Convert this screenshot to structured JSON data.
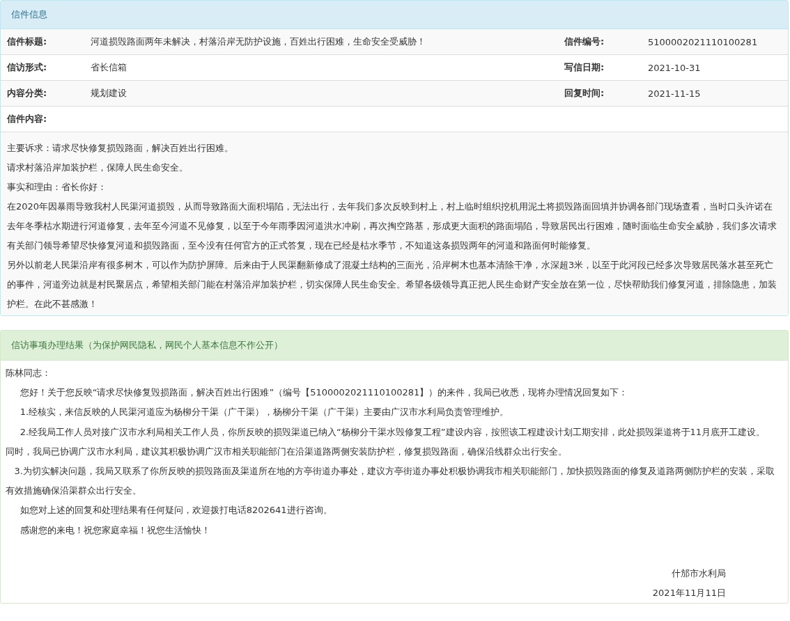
{
  "letter_info": {
    "title": "信件信息",
    "rows": [
      {
        "label": "信件标题:",
        "value": "河道损毁路面两年未解决，村落沿岸无防护设施，百姓出行困难，生命安全受威胁！",
        "label2": "信件编号:",
        "value2": "5100002021110100281"
      },
      {
        "label": "信访形式:",
        "value": "省长信箱",
        "label2": "写信日期:",
        "value2": "2021-10-31"
      },
      {
        "label": "内容分类:",
        "value": "规划建设",
        "label2": "回复时间:",
        "value2": "2021-11-15"
      }
    ],
    "content_label": "信件内容:",
    "content": [
      "主要诉求：请求尽快修复损毁路面，解决百姓出行困难。",
      "请求村落沿岸加装护栏，保障人民生命安全。",
      "事实和理由：省长你好：",
      "在2020年因暴雨导致我村人民渠河道损毁，从而导致路面大面积塌陷，无法出行，去年我们多次反映到村上，村上临时组织挖机用泥土将损毁路面回填并协调各部门现场查看，当时口头许诺在去年冬季枯水期进行河道修复，去年至今河道不见修复，以至于今年雨季因河道洪水冲刷，再次掏空路基，形成更大面积的路面塌陷，导致居民出行困难，随时面临生命安全威胁，我们多次请求有关部门领导希望尽快修复河道和损毁路面，至今没有任何官方的正式答复，现在已经是枯水季节，不知道这条损毁两年的河道和路面何时能修复。",
      "另外以前老人民渠沿岸有很多树木，可以作为防护屏障。后来由于人民渠翻新修成了混凝土结构的三面光，沿岸树木也基本清除干净，水深超3米，以至于此河段已经多次导致居民落水甚至死亡的事件，河道旁边就是村民聚居点，希望相关部门能在村落沿岸加装护栏，切实保障人民生命安全。希望各级领导真正把人民生命财产安全放在第一位，尽快帮助我们修复河道，排除隐患，加装护栏。在此不甚感激！"
    ]
  },
  "reply": {
    "title": "信访事项办理结果（为保护网民隐私，网民个人基本信息不作公开）",
    "paragraphs": [
      "陈林同志：",
      "     您好！关于您反映“请求尽快修复毁损路面，解决百姓出行困难”（编号【5100002021110100281】）的来件，我局已收悉，现将办理情况回复如下：",
      "     1.经核实，来信反映的人民渠河道应为杨柳分干渠（广干渠），杨柳分干渠（广干渠）主要由广汉市水利局负责管理维护。",
      "     2.经我局工作人员对接广汉市水利局相关工作人员，你所反映的损毁渠道已纳入“杨柳分干渠水毁修复工程”建设内容，按照该工程建设计划工期安排，此处损毁渠道将于11月底开工建设。",
      "同时，我局已协调广汉市水利局，建议其积极协调广汉市相关职能部门在沿渠道路两侧安装防护栏，修复损毁路面，确保沿线群众出行安全。",
      "   3.为切实解决问题，我局又联系了你所反映的损毁路面及渠道所在地的方亭街道办事处，建议方亭街道办事处积极协调我市相关职能部门，加快损毁路面的修复及道路两侧防护栏的安装，采取有效措施确保沿渠群众出行安全。",
      "     如您对上述的回复和处理结果有任何疑问，欢迎拨打电话8202641进行咨询。",
      "     感谢您的来电！祝您家庭幸福！祝您生活愉快！"
    ],
    "signature_org": "什邡市水利局",
    "signature_date": "2021年11月11日"
  }
}
